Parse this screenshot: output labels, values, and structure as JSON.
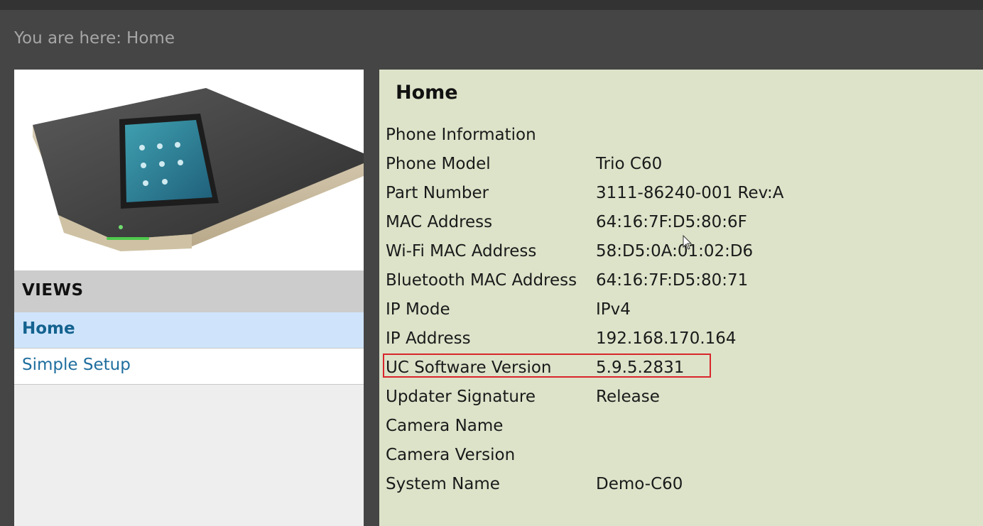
{
  "breadcrumb": {
    "prefix": "You are here:",
    "current": "Home"
  },
  "sidebar": {
    "views_header": "VIEWS",
    "items": [
      {
        "label": "Home",
        "active": true
      },
      {
        "label": "Simple Setup",
        "active": false
      }
    ]
  },
  "main": {
    "title": "Home",
    "section_label": "Phone Information",
    "rows": [
      {
        "label": "Phone Model",
        "value": "Trio C60"
      },
      {
        "label": "Part Number",
        "value": "3111-86240-001 Rev:A"
      },
      {
        "label": "MAC Address",
        "value": "64:16:7F:D5:80:6F"
      },
      {
        "label": "Wi-Fi MAC Address",
        "value": "58:D5:0A:01:02:D6"
      },
      {
        "label": "Bluetooth MAC Address",
        "value": "64:16:7F:D5:80:71"
      },
      {
        "label": "IP Mode",
        "value": "IPv4"
      },
      {
        "label": "IP Address",
        "value": "192.168.170.164"
      },
      {
        "label": "UC Software Version",
        "value": "5.9.5.2831"
      },
      {
        "label": "Updater Signature",
        "value": "Release"
      },
      {
        "label": "Camera Name",
        "value": ""
      },
      {
        "label": "Camera Version",
        "value": ""
      },
      {
        "label": "System Name",
        "value": "Demo-C60"
      }
    ]
  },
  "colors": {
    "highlight": "#d9262c",
    "panel_bg": "#dce3c9",
    "nav_active": "#cfe4fb",
    "link": "#1f6e9e"
  }
}
